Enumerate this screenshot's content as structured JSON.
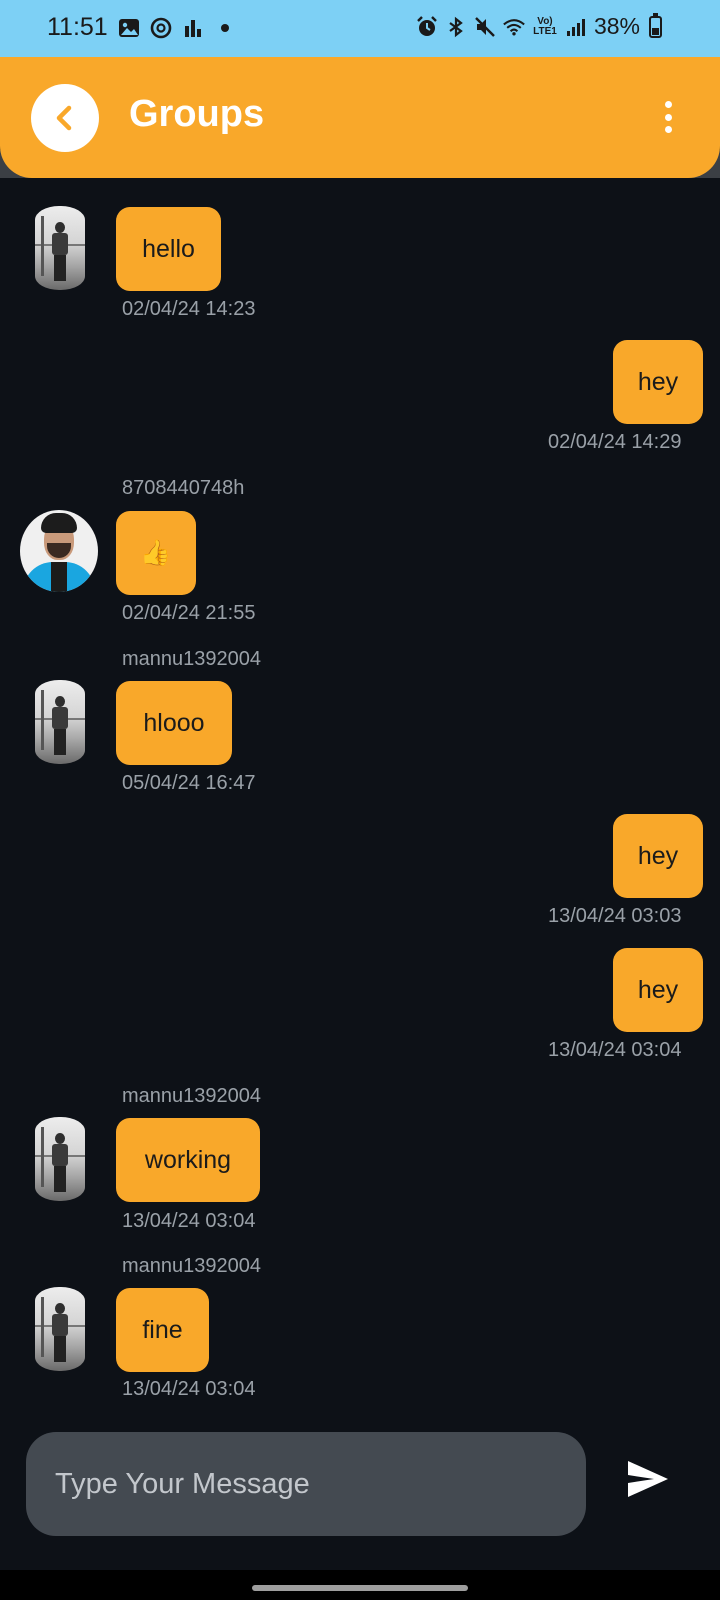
{
  "status_bar": {
    "time": "11:51",
    "battery": "38%",
    "battery_level": 0.38,
    "left_icons": [
      "gallery-icon",
      "threads-icon",
      "bar-chart-icon",
      "dot-icon"
    ],
    "right_icons": [
      "alarm-icon",
      "bluetooth-icon",
      "mute-icon",
      "wifi-icon",
      "volte-icon",
      "signal-icon"
    ],
    "volte_label": "Vo) LTE1"
  },
  "header": {
    "title": "Groups",
    "background": "#f9a82a"
  },
  "messages": [
    {
      "side": "left",
      "sender": "",
      "text": "hello",
      "timestamp": "02/04/24 14:23",
      "avatar": "bw"
    },
    {
      "side": "right",
      "text": "hey",
      "timestamp": "02/04/24 14:29"
    },
    {
      "side": "left",
      "sender": "8708440748h",
      "text": "👍",
      "timestamp": "02/04/24 21:55",
      "avatar": "color"
    },
    {
      "side": "left",
      "sender": "mannu1392004",
      "text": "hlooo",
      "timestamp": "05/04/24 16:47",
      "avatar": "bw"
    },
    {
      "side": "right",
      "text": "hey",
      "timestamp": "13/04/24 03:03"
    },
    {
      "side": "right",
      "text": "hey",
      "timestamp": "13/04/24 03:04"
    },
    {
      "side": "left",
      "sender": "mannu1392004",
      "text": "working",
      "timestamp": "13/04/24 03:04",
      "avatar": "bw"
    },
    {
      "side": "left",
      "sender": "mannu1392004",
      "text": "fine",
      "timestamp": "13/04/24 03:04",
      "avatar": "bw"
    }
  ],
  "composer": {
    "placeholder": "Type Your Message",
    "value": ""
  },
  "colors": {
    "bubble": "#f9a82a",
    "chat_background": "#0d1117",
    "status_bar": "#7dd0f5",
    "input_background": "#444a51"
  }
}
